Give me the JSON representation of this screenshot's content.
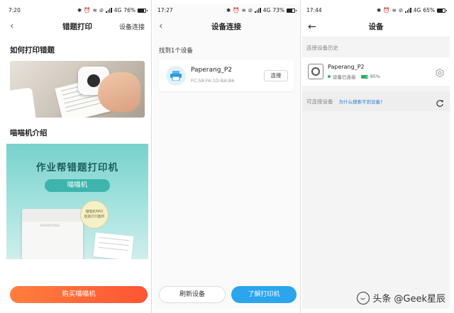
{
  "screens": [
    {
      "status": {
        "time": "7:20",
        "network": "4G",
        "battery_text": "76%",
        "battery_level": 0.76
      },
      "nav": {
        "back_icon": "chevron-left-icon",
        "title": "错题打印",
        "action": "设备连接"
      },
      "section1_title": "如何打印错题",
      "section2_title": "喵喵机介绍",
      "promo": {
        "title": "作业帮错题打印机",
        "pill": "喵喵机",
        "badge_line1": "喵喵机MAX",
        "badge_line2": "超宽打印面积",
        "device_brand": "PAPERANG"
      },
      "buy_button": "购买喵喵机"
    },
    {
      "status": {
        "time": "17:27",
        "network": "4G",
        "battery_text": "73%",
        "battery_level": 0.73
      },
      "nav": {
        "back_icon": "chevron-left-icon",
        "title": "设备连接"
      },
      "found_label": "找到1个设备",
      "device": {
        "name": "Paperang_P2",
        "mac": "FC:58:FA:1D:BA:B6",
        "connect_label": "连接"
      },
      "refresh_button": "刷新设备",
      "learn_button": "了解打印机"
    },
    {
      "status": {
        "time": "17:44",
        "network": "4G",
        "battery_text": "65%",
        "battery_level": 0.65
      },
      "nav": {
        "back_icon": "arrow-left-icon",
        "title": "设备"
      },
      "history_label": "连接设备历史",
      "device": {
        "name": "Paperang_P2",
        "status": "设备已连接",
        "battery_text": "95%",
        "battery_level": 0.95
      },
      "available_label": "可连接设备",
      "help_link": "为什么搜索不到设备?"
    }
  ],
  "watermark": "头条 @Geek星辰",
  "colors": {
    "orange": "#ff6a35",
    "blue": "#2aa5ee",
    "teal": "#78d2cd",
    "green": "#29b35f"
  }
}
